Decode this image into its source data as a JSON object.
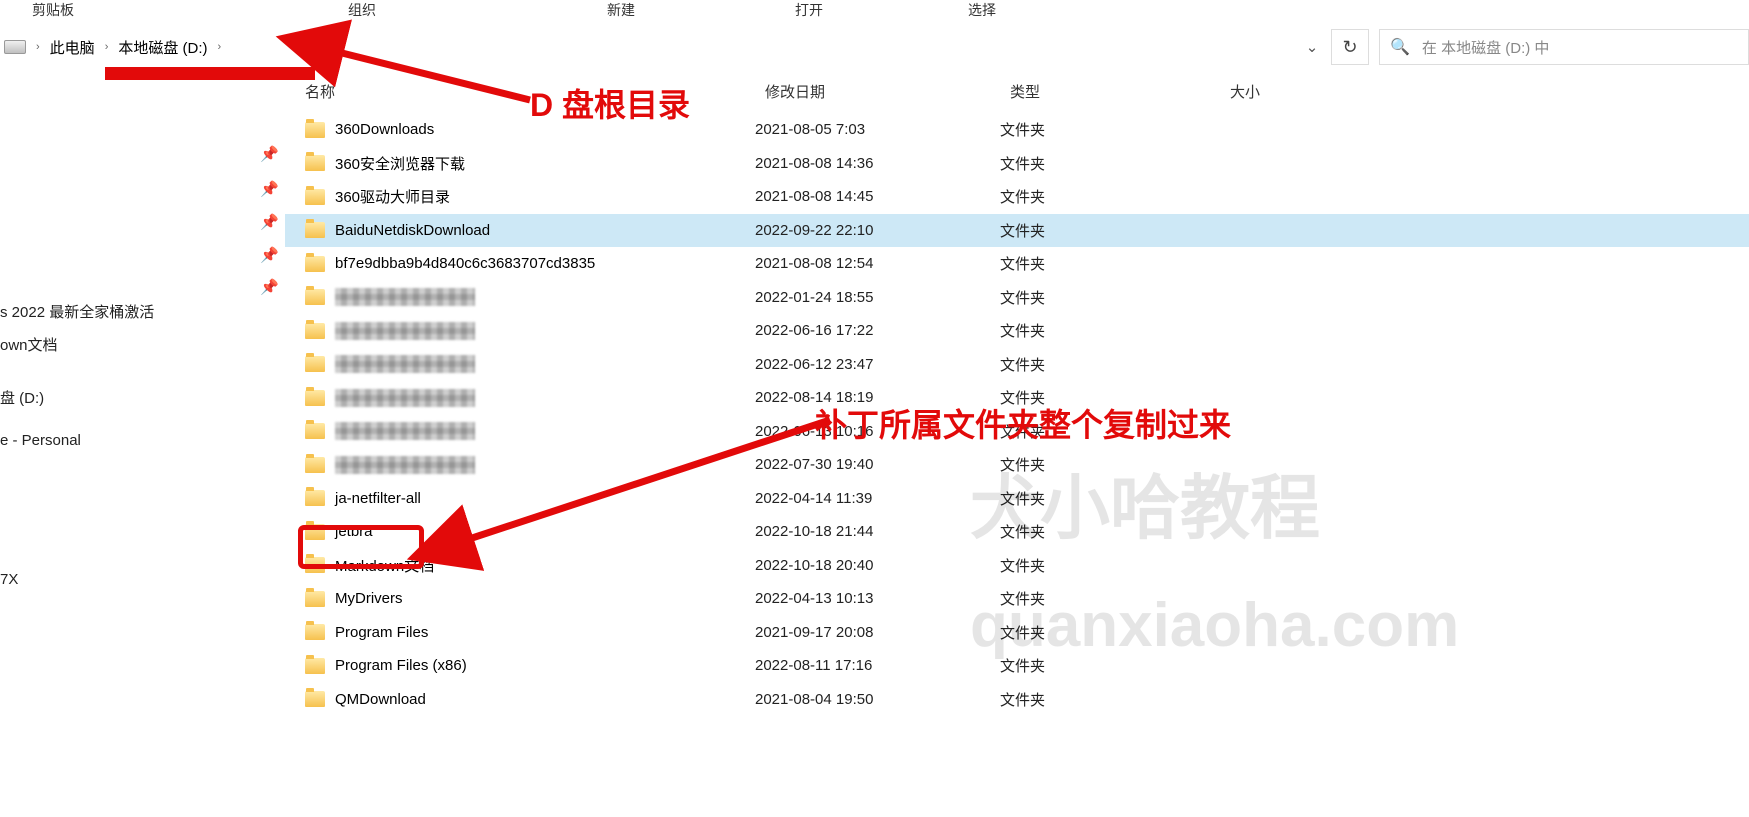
{
  "ribbon": {
    "clipboard": "剪贴板",
    "organize": "组织",
    "new": "新建",
    "open": "打开",
    "select": "选择"
  },
  "breadcrumb": {
    "pc": "此电脑",
    "drive": "本地磁盘 (D:)"
  },
  "search": {
    "placeholder": "在 本地磁盘 (D:) 中"
  },
  "columns": {
    "name": "名称",
    "date": "修改日期",
    "type": "类型",
    "size": "大小"
  },
  "type_folder": "文件夹",
  "rows": [
    {
      "name": "360Downloads",
      "date": "2021-08-05 7:03",
      "pixelated": false,
      "selected": false
    },
    {
      "name": "360安全浏览器下载",
      "date": "2021-08-08 14:36",
      "pixelated": false,
      "selected": false
    },
    {
      "name": "360驱动大师目录",
      "date": "2021-08-08 14:45",
      "pixelated": false,
      "selected": false
    },
    {
      "name": "BaiduNetdiskDownload",
      "date": "2022-09-22 22:10",
      "pixelated": false,
      "selected": true
    },
    {
      "name": "bf7e9dbba9b4d840c6c3683707cd3835",
      "date": "2021-08-08 12:54",
      "pixelated": false,
      "selected": false
    },
    {
      "name": "",
      "date": "2022-01-24 18:55",
      "pixelated": true,
      "selected": false
    },
    {
      "name": "",
      "date": "2022-06-16 17:22",
      "pixelated": true,
      "selected": false
    },
    {
      "name": "",
      "date": "2022-06-12 23:47",
      "pixelated": true,
      "selected": false
    },
    {
      "name": "",
      "date": "2022-08-14 18:19",
      "pixelated": true,
      "selected": false
    },
    {
      "name": "",
      "date": "2022-06-13 10:16",
      "pixelated": true,
      "selected": false
    },
    {
      "name": "",
      "date": "2022-07-30 19:40",
      "pixelated": true,
      "selected": false
    },
    {
      "name": "ja-netfilter-all",
      "date": "2022-04-14 11:39",
      "pixelated": false,
      "selected": false
    },
    {
      "name": "jetbra",
      "date": "2022-10-18 21:44",
      "pixelated": false,
      "selected": false
    },
    {
      "name": "Markdown文档",
      "date": "2022-10-18 20:40",
      "pixelated": false,
      "selected": false
    },
    {
      "name": "MyDrivers",
      "date": "2022-04-13 10:13",
      "pixelated": false,
      "selected": false
    },
    {
      "name": "Program Files",
      "date": "2021-09-17 20:08",
      "pixelated": false,
      "selected": false
    },
    {
      "name": "Program Files (x86)",
      "date": "2022-08-11 17:16",
      "pixelated": false,
      "selected": false
    },
    {
      "name": "QMDownload",
      "date": "2021-08-04 19:50",
      "pixelated": false,
      "selected": false
    }
  ],
  "nav": {
    "item1": "s  2022 最新全家桶激活",
    "item2": "own文档",
    "item3": "盘 (D:)",
    "item4": "e - Personal",
    "item5": "7X"
  },
  "annotations": {
    "label1": "D 盘根目录",
    "label2": "补丁所属文件夹整个复制过来"
  },
  "watermark": {
    "line1": "犬小哈教程",
    "line2": "quanxiaoha.com"
  }
}
